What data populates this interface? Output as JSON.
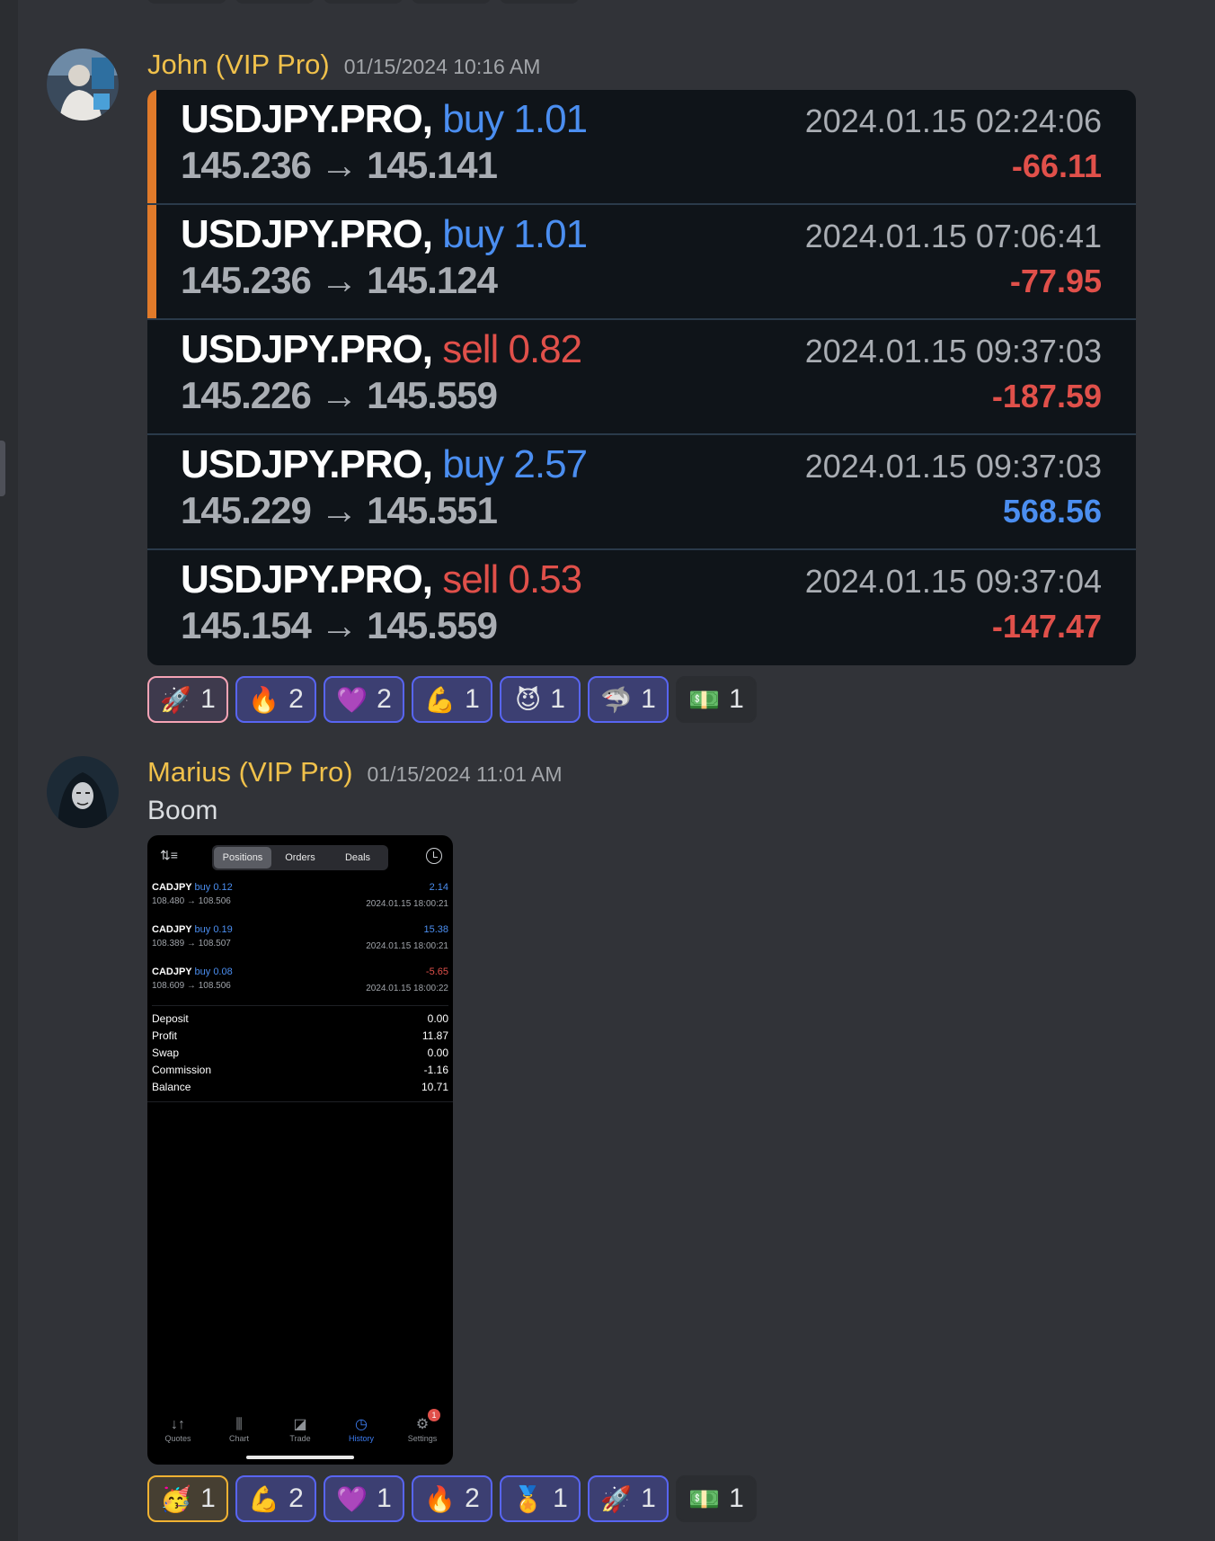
{
  "messages": [
    {
      "username": "John (VIP Pro)",
      "timestamp": "01/15/2024 10:16 AM",
      "trades": [
        {
          "symbol": "USDJPY.PRO,",
          "side": "buy",
          "volume": "1.01",
          "open": "145.236",
          "arrow": "→",
          "close": "145.141",
          "date": "2024.01.15 02:24:06",
          "profit": "-66.11"
        },
        {
          "symbol": "USDJPY.PRO,",
          "side": "buy",
          "volume": "1.01",
          "open": "145.236",
          "arrow": "→",
          "close": "145.124",
          "date": "2024.01.15 07:06:41",
          "profit": "-77.95"
        },
        {
          "symbol": "USDJPY.PRO,",
          "side": "sell",
          "volume": "0.82",
          "open": "145.226",
          "arrow": "→",
          "close": "145.559",
          "date": "2024.01.15 09:37:03",
          "profit": "-187.59"
        },
        {
          "symbol": "USDJPY.PRO,",
          "side": "buy",
          "volume": "2.57",
          "open": "145.229",
          "arrow": "→",
          "close": "145.551",
          "date": "2024.01.15 09:37:03",
          "profit": "568.56"
        },
        {
          "symbol": "USDJPY.PRO,",
          "side": "sell",
          "volume": "0.53",
          "open": "145.154",
          "arrow": "→",
          "close": "145.559",
          "date": "2024.01.15 09:37:04",
          "profit": "-147.47"
        }
      ],
      "reactions": [
        {
          "emoji": "🚀",
          "count": "1",
          "name": "rocket"
        },
        {
          "emoji": "🔥",
          "count": "2",
          "name": "fire"
        },
        {
          "emoji": "💜",
          "count": "2",
          "name": "purple-heart"
        },
        {
          "emoji": "💪",
          "count": "1",
          "name": "muscle"
        },
        {
          "emoji": "😈",
          "count": "1",
          "name": "smiling-imp"
        },
        {
          "emoji": "🦈",
          "count": "1",
          "name": "shark"
        },
        {
          "emoji": "💵",
          "count": "1",
          "name": "dollar"
        }
      ]
    },
    {
      "username": "Marius (VIP Pro)",
      "timestamp": "01/15/2024 11:01 AM",
      "text": "Boom",
      "screenshot": {
        "tabs": [
          "Positions",
          "Orders",
          "Deals"
        ],
        "positions": [
          {
            "symbol": "CADJPY",
            "side": "buy",
            "volume": "0.12",
            "open": "108.480",
            "close": "108.506",
            "profit": "2.14",
            "date": "2024.01.15 18:00:21"
          },
          {
            "symbol": "CADJPY",
            "side": "buy",
            "volume": "0.19",
            "open": "108.389",
            "close": "108.507",
            "profit": "15.38",
            "date": "2024.01.15 18:00:21"
          },
          {
            "symbol": "CADJPY",
            "side": "buy",
            "volume": "0.08",
            "open": "108.609",
            "close": "108.506",
            "profit": "-5.65",
            "date": "2024.01.15 18:00:22"
          }
        ],
        "summary": [
          {
            "label": "Deposit",
            "value": "0.00"
          },
          {
            "label": "Profit",
            "value": "11.87"
          },
          {
            "label": "Swap",
            "value": "0.00"
          },
          {
            "label": "Commission",
            "value": "-1.16"
          },
          {
            "label": "Balance",
            "value": "10.71"
          }
        ],
        "nav": [
          {
            "label": "Quotes",
            "icon": "↓↑"
          },
          {
            "label": "Chart",
            "icon": "⫼"
          },
          {
            "label": "Trade",
            "icon": "◪"
          },
          {
            "label": "History",
            "icon": "◷"
          },
          {
            "label": "Settings",
            "icon": "⚙"
          }
        ],
        "settings_badge": "1"
      },
      "reactions": [
        {
          "emoji": "🥳",
          "count": "1",
          "name": "partying-face"
        },
        {
          "emoji": "💪",
          "count": "2",
          "name": "muscle"
        },
        {
          "emoji": "💜",
          "count": "1",
          "name": "purple-heart"
        },
        {
          "emoji": "🔥",
          "count": "2",
          "name": "fire"
        },
        {
          "emoji": "🏅",
          "count": "1",
          "name": "medal"
        },
        {
          "emoji": "🚀",
          "count": "1",
          "name": "rocket"
        },
        {
          "emoji": "💵",
          "count": "1",
          "name": "dollar"
        }
      ]
    }
  ],
  "colors": {
    "username": "#f0c14b",
    "buy": "#4b8ef0",
    "sell": "#e0504a",
    "reaction_border": "#5865f2"
  }
}
